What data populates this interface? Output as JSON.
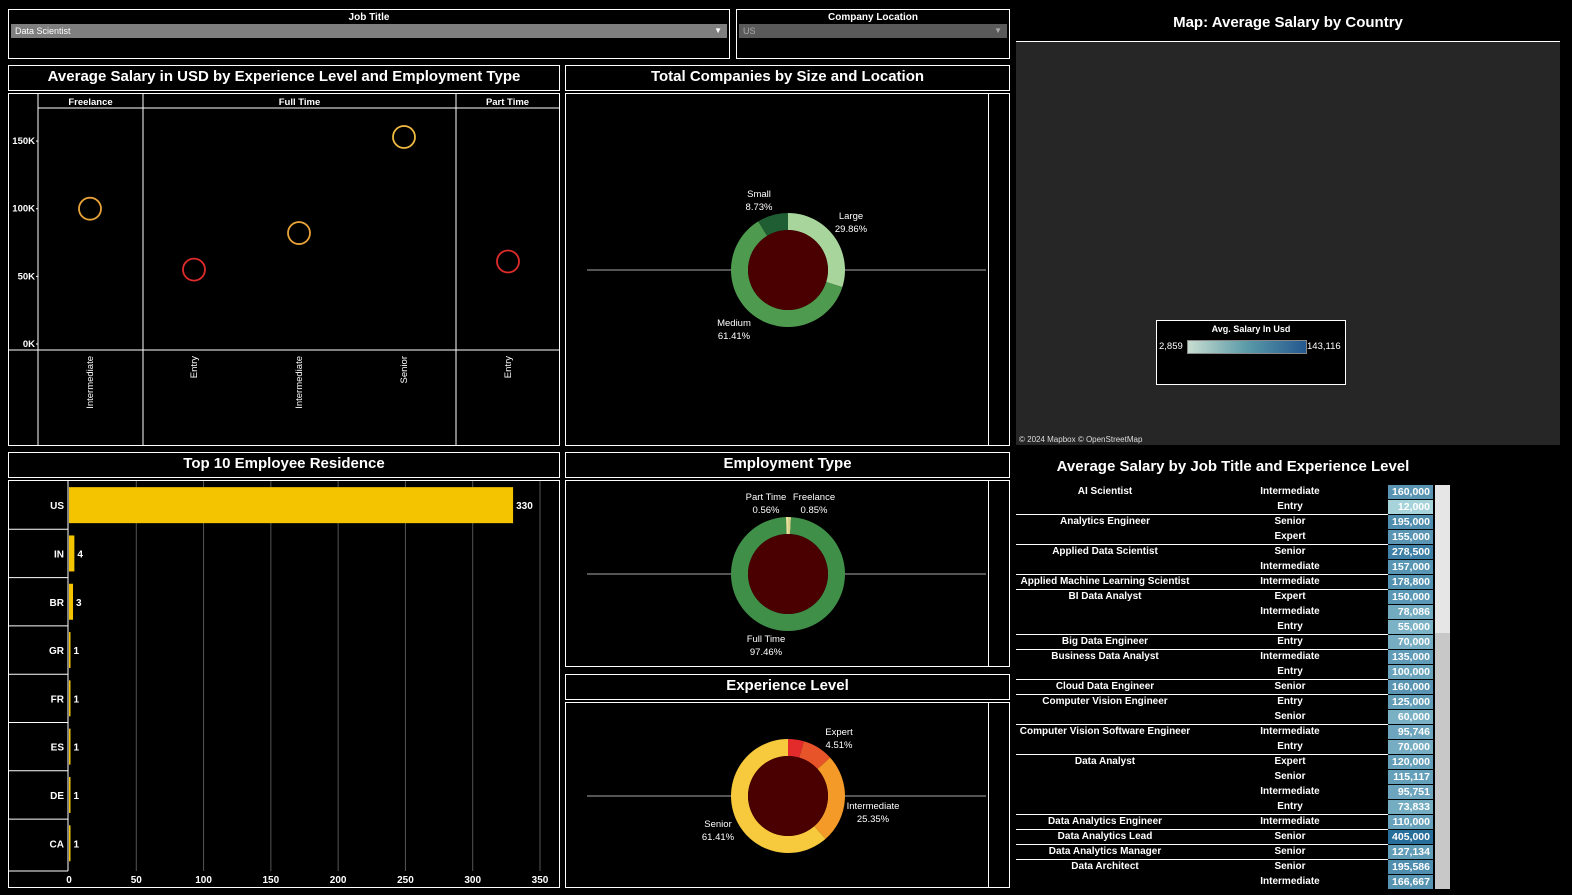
{
  "filters": {
    "job_title": {
      "label": "Job Title",
      "value": "Data Scientist"
    },
    "company_location": {
      "label": "Company Location",
      "value": "US"
    }
  },
  "scatter": {
    "title": "Average Salary in USD by Experience Level and Employment Type",
    "panels": [
      "Freelance",
      "Full Time",
      "Part Time"
    ],
    "y_ticks": [
      "150K",
      "100K",
      "50K",
      "0K"
    ],
    "x_labels": [
      "Intermediate",
      "Entry",
      "Intermediate",
      "Senior",
      "Entry"
    ]
  },
  "companies": {
    "title": "Total Companies by Size and Location",
    "labels": [
      {
        "name": "Small",
        "pct": "8.73%"
      },
      {
        "name": "Large",
        "pct": "29.86%"
      },
      {
        "name": "Medium",
        "pct": "61.41%"
      }
    ]
  },
  "employment": {
    "title": "Employment Type",
    "labels": [
      {
        "name": "Part Time",
        "pct": "0.56%"
      },
      {
        "name": "Freelance",
        "pct": "0.85%"
      },
      {
        "name": "Full Time",
        "pct": "97.46%"
      }
    ]
  },
  "experience": {
    "title": "Experience Level",
    "labels": [
      {
        "name": "Expert",
        "pct": "4.51%"
      },
      {
        "name": "Intermediate",
        "pct": "25.35%"
      },
      {
        "name": "Senior",
        "pct": "61.41%"
      }
    ]
  },
  "map": {
    "title": "Map: Average Salary by Country",
    "legend_title": "Avg. Salary In Usd",
    "legend_min": "2,859",
    "legend_max": "143,116",
    "attribution": "© 2024 Mapbox  © OpenStreetMap"
  },
  "residence": {
    "title": "Top 10 Employee Residence",
    "x_ticks": [
      "0",
      "50",
      "100",
      "150",
      "200",
      "250",
      "300",
      "350"
    ]
  },
  "salary_table": {
    "title": "Average Salary by Job Title and Experience Level",
    "rows": [
      {
        "title": "AI Scientist",
        "exp": "Intermediate",
        "val": "160,000",
        "v": 160000,
        "sep": false
      },
      {
        "title": "",
        "exp": "Entry",
        "val": "12,000",
        "v": 12000,
        "sep": true
      },
      {
        "title": "Analytics Engineer",
        "exp": "Senior",
        "val": "195,000",
        "v": 195000,
        "sep": false
      },
      {
        "title": "",
        "exp": "Expert",
        "val": "155,000",
        "v": 155000,
        "sep": true
      },
      {
        "title": "Applied Data Scientist",
        "exp": "Senior",
        "val": "278,500",
        "v": 278500,
        "sep": false
      },
      {
        "title": "",
        "exp": "Intermediate",
        "val": "157,000",
        "v": 157000,
        "sep": true
      },
      {
        "title": "Applied Machine Learning Scientist",
        "exp": "Intermediate",
        "val": "178,800",
        "v": 178800,
        "sep": true
      },
      {
        "title": "BI Data Analyst",
        "exp": "Expert",
        "val": "150,000",
        "v": 150000,
        "sep": false
      },
      {
        "title": "",
        "exp": "Intermediate",
        "val": "78,086",
        "v": 78086,
        "sep": false
      },
      {
        "title": "",
        "exp": "Entry",
        "val": "55,000",
        "v": 55000,
        "sep": true
      },
      {
        "title": "Big Data Engineer",
        "exp": "Entry",
        "val": "70,000",
        "v": 70000,
        "sep": true
      },
      {
        "title": "Business Data Analyst",
        "exp": "Intermediate",
        "val": "135,000",
        "v": 135000,
        "sep": false
      },
      {
        "title": "",
        "exp": "Entry",
        "val": "100,000",
        "v": 100000,
        "sep": true
      },
      {
        "title": "Cloud Data Engineer",
        "exp": "Senior",
        "val": "160,000",
        "v": 160000,
        "sep": true
      },
      {
        "title": "Computer Vision Engineer",
        "exp": "Entry",
        "val": "125,000",
        "v": 125000,
        "sep": false
      },
      {
        "title": "",
        "exp": "Senior",
        "val": "60,000",
        "v": 60000,
        "sep": true
      },
      {
        "title": "Computer Vision Software Engineer",
        "exp": "Intermediate",
        "val": "95,746",
        "v": 95746,
        "sep": false
      },
      {
        "title": "",
        "exp": "Entry",
        "val": "70,000",
        "v": 70000,
        "sep": true
      },
      {
        "title": "Data Analyst",
        "exp": "Expert",
        "val": "120,000",
        "v": 120000,
        "sep": false
      },
      {
        "title": "",
        "exp": "Senior",
        "val": "115,117",
        "v": 115117,
        "sep": false
      },
      {
        "title": "",
        "exp": "Intermediate",
        "val": "95,751",
        "v": 95751,
        "sep": false
      },
      {
        "title": "",
        "exp": "Entry",
        "val": "73,833",
        "v": 73833,
        "sep": true
      },
      {
        "title": "Data Analytics Engineer",
        "exp": "Intermediate",
        "val": "110,000",
        "v": 110000,
        "sep": true
      },
      {
        "title": "Data Analytics Lead",
        "exp": "Senior",
        "val": "405,000",
        "v": 405000,
        "sep": true
      },
      {
        "title": "Data Analytics Manager",
        "exp": "Senior",
        "val": "127,134",
        "v": 127134,
        "sep": true
      },
      {
        "title": "Data Architect",
        "exp": "Senior",
        "val": "195,586",
        "v": 195586,
        "sep": false
      },
      {
        "title": "",
        "exp": "Intermediate",
        "val": "166,667",
        "v": 166667,
        "sep": false
      }
    ]
  },
  "chart_data": [
    {
      "type": "scatter",
      "title": "Average Salary in USD by Experience Level and Employment Type",
      "ylim": [
        0,
        170000
      ],
      "points": [
        {
          "panel": "Freelance",
          "x": "Intermediate",
          "y": 100000,
          "color": "#e8a33a"
        },
        {
          "panel": "Full Time",
          "x": "Entry",
          "y": 55000,
          "color": "#e02b2b"
        },
        {
          "panel": "Full Time",
          "x": "Intermediate",
          "y": 82000,
          "color": "#e8a33a"
        },
        {
          "panel": "Full Time",
          "x": "Senior",
          "y": 153000,
          "color": "#f0b940"
        },
        {
          "panel": "Part Time",
          "x": "Entry",
          "y": 61000,
          "color": "#e02b2b"
        }
      ]
    },
    {
      "type": "pie",
      "title": "Total Companies by Size and Location",
      "categories": [
        "Large",
        "Medium",
        "Small"
      ],
      "values": [
        29.86,
        61.41,
        8.73
      ],
      "colors": [
        "#a8d59c",
        "#4e9a4e",
        "#1f5e32"
      ]
    },
    {
      "type": "pie",
      "title": "Employment Type",
      "categories": [
        "Freelance",
        "Full Time",
        "Part Time"
      ],
      "values": [
        0.85,
        97.46,
        0.56
      ],
      "colors": [
        "#d8d28a",
        "#3f8f48",
        "#eae4a0"
      ]
    },
    {
      "type": "pie",
      "title": "Experience Level",
      "categories": [
        "Expert",
        "Intermediate",
        "Senior"
      ],
      "values": [
        4.51,
        25.35,
        61.41
      ],
      "other": [
        8.73
      ],
      "colors": [
        "#e32b2b",
        "#f39a28",
        "#f7c93c",
        "#e8542a"
      ]
    },
    {
      "type": "bar",
      "title": "Top 10 Employee Residence",
      "categories": [
        "US",
        "IN",
        "BR",
        "GR",
        "FR",
        "ES",
        "DE",
        "CA"
      ],
      "values": [
        330,
        4,
        3,
        1,
        1,
        1,
        1,
        1
      ],
      "xlim": [
        0,
        350
      ],
      "color": "#f5c400"
    }
  ]
}
